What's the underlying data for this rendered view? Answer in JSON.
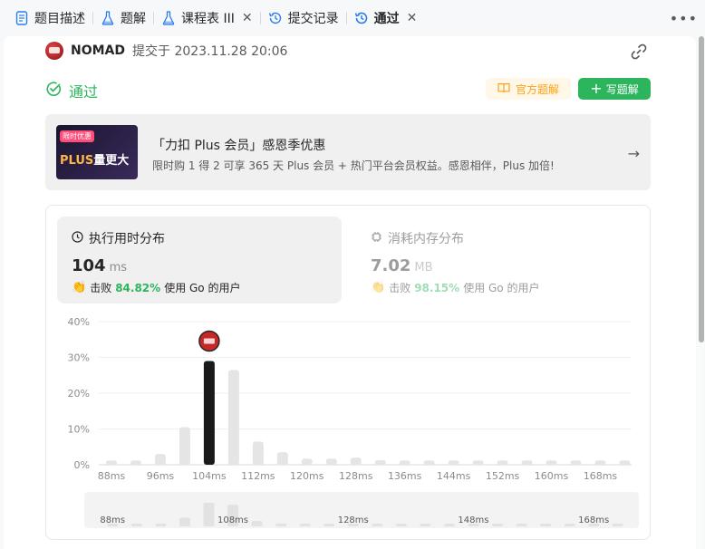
{
  "tabs": [
    {
      "label": "题目描述",
      "icon": "document-icon",
      "closable": false
    },
    {
      "label": "题解",
      "icon": "flask-icon",
      "closable": false
    },
    {
      "label": "课程表 III",
      "icon": "flask-icon",
      "closable": true
    },
    {
      "label": "提交记录",
      "icon": "history-icon",
      "closable": false
    },
    {
      "label": "通过",
      "icon": "history-icon",
      "closable": true,
      "active": true
    }
  ],
  "submission": {
    "author": "NOMAD",
    "submitted_at": "提交于 2023.11.28 20:06",
    "status": "通过",
    "official_solution_label": "官方题解",
    "write_solution_label": "写题解"
  },
  "promo": {
    "badge": "限时优惠",
    "image_text_plus": "PLUS",
    "image_text": "量更大",
    "title": "「力扣 Plus 会员」感恩季优惠",
    "subtitle": "限时购 1 得 2 可享 365 天 Plus 会员 + 热门平台会员权益。感恩相伴，Plus 加倍!"
  },
  "runtime": {
    "label": "执行用时分布",
    "value": "104",
    "unit": "ms",
    "beat_prefix": "击败",
    "beat_pct": "84.82%",
    "beat_suffix": "使用 Go 的用户"
  },
  "memory": {
    "label": "消耗内存分布",
    "value": "7.02",
    "unit": "MB",
    "beat_prefix": "击败",
    "beat_pct": "98.15%",
    "beat_suffix": "使用 Go 的用户"
  },
  "colors": {
    "accent_green": "#2db55d",
    "accent_orange": "#ffa116",
    "bar_highlight": "#1a1a1a",
    "bar_default": "#e5e5e5"
  },
  "chart_data": {
    "type": "bar",
    "x_tick_labels": [
      "88ms",
      "96ms",
      "104ms",
      "112ms",
      "120ms",
      "128ms",
      "136ms",
      "144ms",
      "152ms",
      "160ms",
      "168ms"
    ],
    "y_tick_labels": [
      "40%",
      "30%",
      "20%",
      "10%",
      "0%"
    ],
    "ylim": [
      0,
      40
    ],
    "x": [
      88,
      92,
      96,
      100,
      104,
      108,
      112,
      116,
      120,
      124,
      128,
      132,
      136,
      140,
      144,
      148,
      152,
      156,
      160,
      164,
      168,
      172
    ],
    "values": [
      1.2,
      1.2,
      3.0,
      10.5,
      29,
      26.5,
      6.5,
      3.5,
      1.7,
      1.7,
      2.0,
      1.3,
      1.2,
      1.2,
      1.2,
      1.2,
      1.2,
      1.2,
      1.2,
      1.2,
      1.2,
      1.2
    ],
    "highlight_x": 104,
    "brush_tick_labels": [
      "88ms",
      "108ms",
      "128ms",
      "148ms",
      "168ms"
    ],
    "grid": true
  }
}
